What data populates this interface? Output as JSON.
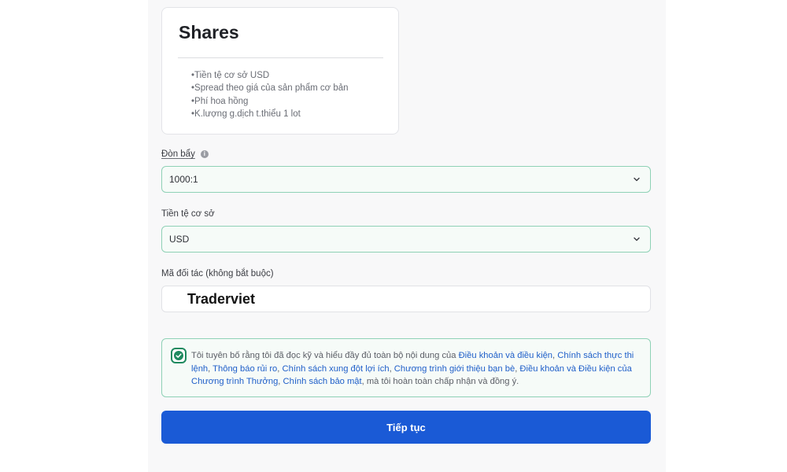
{
  "account_type_card": {
    "title": "Shares",
    "features": [
      "•Tiền tệ cơ sở USD",
      "•Spread theo giá của sản phẩm cơ bản",
      "•Phí hoa hồng",
      "•K.lượng g.dịch t.thiểu 1 lot"
    ]
  },
  "leverage": {
    "label": "Đòn bẩy",
    "info_icon": "info-icon",
    "value": "1000:1"
  },
  "base_currency": {
    "label": "Tiền tệ cơ sở",
    "value": "USD"
  },
  "partner_code": {
    "label": "Mã đối tác (không bắt buộc)",
    "value": "Traderviet"
  },
  "consent": {
    "checked": true,
    "intro": "Tôi tuyên bố rằng tôi đã đọc kỹ và hiểu đầy đủ toàn bộ nội dung của ",
    "links": [
      "Điều khoản và điều kiện",
      "Chính sách thực thi lệnh",
      "Thông báo rủi ro",
      "Chính sách xung đột lợi ích",
      "Chương trình giới thiệu bạn bè",
      "Điều khoản và Điều kiện của Chương trình Thưởng",
      "Chính sách bảo mật"
    ],
    "separator": ", ",
    "outro": ", mà tôi hoàn toàn chấp nhận và đồng ý."
  },
  "submit": {
    "label": "Tiếp tục"
  },
  "colors": {
    "accent_green": "#1f8a5f",
    "field_border_green": "#8fd1b6",
    "link_blue": "#1f5fc9",
    "button_blue": "#1a5ad6"
  }
}
